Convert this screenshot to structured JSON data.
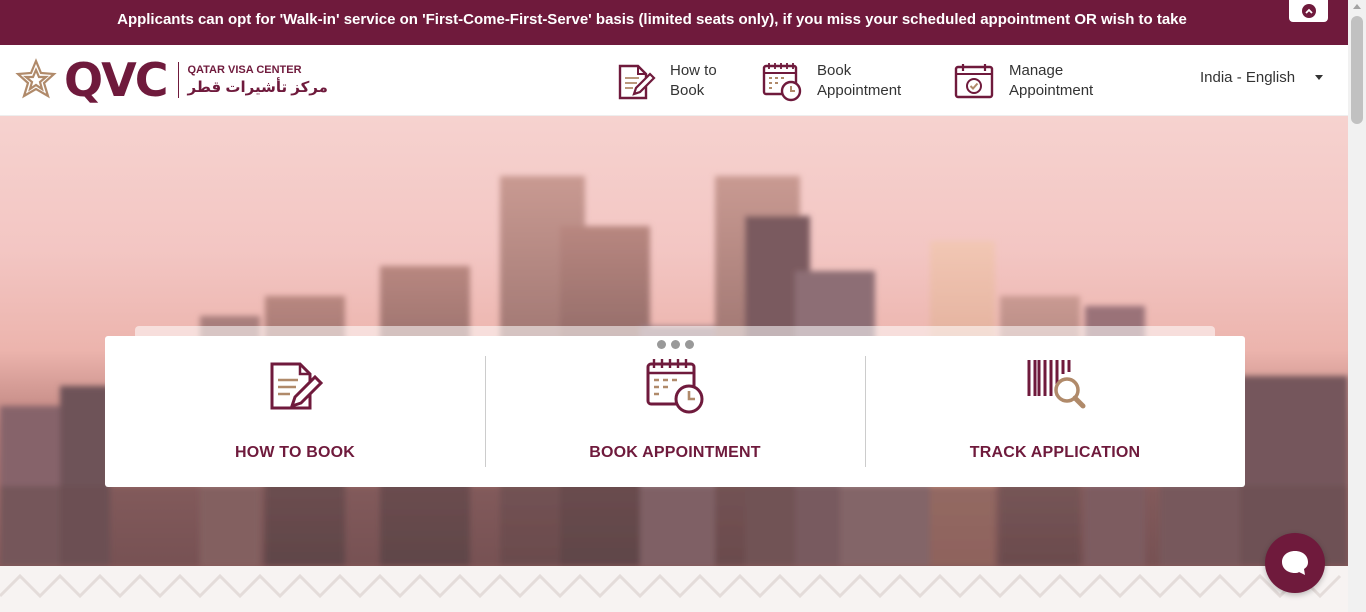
{
  "announcement": {
    "text": "Applicants can opt for 'Walk-in' service on 'First-Come-First-Serve' basis (limited seats only), if you miss your scheduled appointment OR wish to take",
    "toggle_icon": "chevron-up-icon"
  },
  "header": {
    "logo": {
      "brand": "QVC",
      "english": "QATAR VISA CENTER",
      "arabic": "مركز تأشيرات قطر"
    },
    "nav": [
      {
        "label_line1": "How to",
        "label_line2": "Book",
        "icon": "document-edit-icon"
      },
      {
        "label_line1": "Book",
        "label_line2": "Appointment",
        "icon": "calendar-clock-icon"
      },
      {
        "label_line1": "Manage",
        "label_line2": "Appointment",
        "icon": "calendar-check-icon"
      }
    ],
    "language": "India - English"
  },
  "cards": [
    {
      "label": "HOW TO BOOK",
      "icon": "document-edit-icon"
    },
    {
      "label": "BOOK APPOINTMENT",
      "icon": "calendar-clock-icon"
    },
    {
      "label": "TRACK APPLICATION",
      "icon": "barcode-search-icon"
    }
  ],
  "colors": {
    "brand": "#6f1a3c",
    "accent_tan": "#b08a6a"
  },
  "chat": {
    "icon": "chat-bubble-icon"
  }
}
